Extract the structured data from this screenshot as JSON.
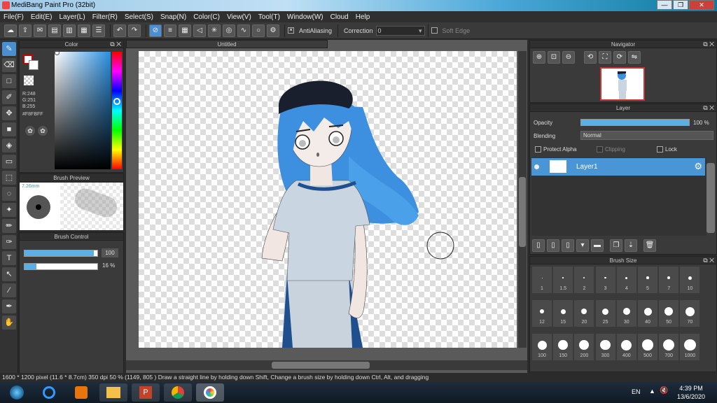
{
  "window": {
    "title": "MediBang Paint Pro (32bit)",
    "minimize": "—",
    "restore": "❐",
    "close": "✕"
  },
  "menu": [
    "File(F)",
    "Edit(E)",
    "Layer(L)",
    "Filter(R)",
    "Select(S)",
    "Snap(N)",
    "Color(C)",
    "View(V)",
    "Tool(T)",
    "Window(W)",
    "Cloud",
    "Help"
  ],
  "toolbar": {
    "antialiasing": "AntiAliasing",
    "correction_label": "Correction",
    "correction_value": "0",
    "soft_edge": "Soft Edge"
  },
  "color_panel": {
    "title": "Color",
    "r": "R:248",
    "g": "G:251",
    "b": "B:255",
    "hex": "#F8FBFF"
  },
  "brush_preview": {
    "title": "Brush Preview",
    "size": "7.26mm"
  },
  "brush_control": {
    "title": "Brush Control",
    "size_value": "100",
    "opacity_value": "16 %",
    "size_fraction": 0.95,
    "opacity_fraction": 0.16
  },
  "document": {
    "tab": "Untitled"
  },
  "navigator": {
    "title": "Navigator"
  },
  "layer_panel": {
    "title": "Layer",
    "opacity_label": "Opacity",
    "opacity_value": "100 %",
    "opacity_fraction": 1.0,
    "blending_label": "Blending",
    "blending_value": "Normal",
    "protect_alpha": "Protect Alpha",
    "clipping": "Clipping",
    "lock": "Lock",
    "layers": [
      {
        "name": "Layer1"
      }
    ]
  },
  "brush_size": {
    "title": "Brush Size",
    "sizes": [
      "1",
      "1.5",
      "2",
      "3",
      "4",
      "5",
      "7",
      "10",
      "12",
      "15",
      "20",
      "25",
      "30",
      "40",
      "50",
      "70",
      "100",
      "150",
      "200",
      "300",
      "400",
      "500",
      "700",
      "1000"
    ]
  },
  "status": {
    "text": "1600 * 1200 pixel  (11.6 * 8.7cm)  350 dpi  50 %  (1149, 805 )  Draw a straight line by holding down Shift, Change a brush size by holding down Ctrl, Alt, and dragging"
  },
  "taskbar": {
    "lang": "EN",
    "time": "4:39 PM",
    "date": "13/6/2020"
  },
  "colors": {
    "accent": "#4a95d6",
    "hair": "#3d8fe0",
    "cap": "#1a1f2e"
  }
}
